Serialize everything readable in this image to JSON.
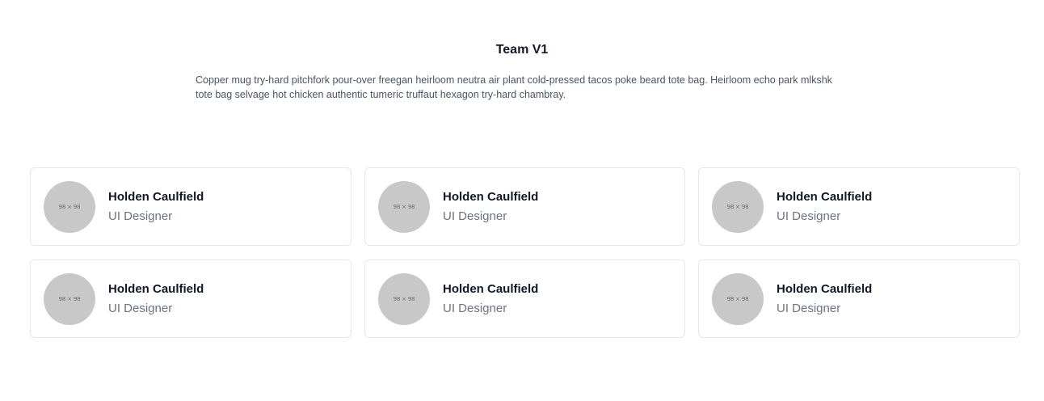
{
  "section": {
    "title": "Team V1",
    "description": "Copper mug try-hard pitchfork pour-over freegan heirloom neutra air plant cold-pressed tacos poke beard tote bag. Heirloom echo park mlkshk tote bag selvage hot chicken authentic tumeric truffaut hexagon try-hard chambray."
  },
  "members": [
    {
      "name": "Holden Caulfield",
      "role": "UI Designer",
      "avatar_text": "98 × 98"
    },
    {
      "name": "Holden Caulfield",
      "role": "UI Designer",
      "avatar_text": "98 × 98"
    },
    {
      "name": "Holden Caulfield",
      "role": "UI Designer",
      "avatar_text": "98 × 98"
    },
    {
      "name": "Holden Caulfield",
      "role": "UI Designer",
      "avatar_text": "98 × 98"
    },
    {
      "name": "Holden Caulfield",
      "role": "UI Designer",
      "avatar_text": "98 × 98"
    },
    {
      "name": "Holden Caulfield",
      "role": "UI Designer",
      "avatar_text": "98 × 98"
    }
  ]
}
